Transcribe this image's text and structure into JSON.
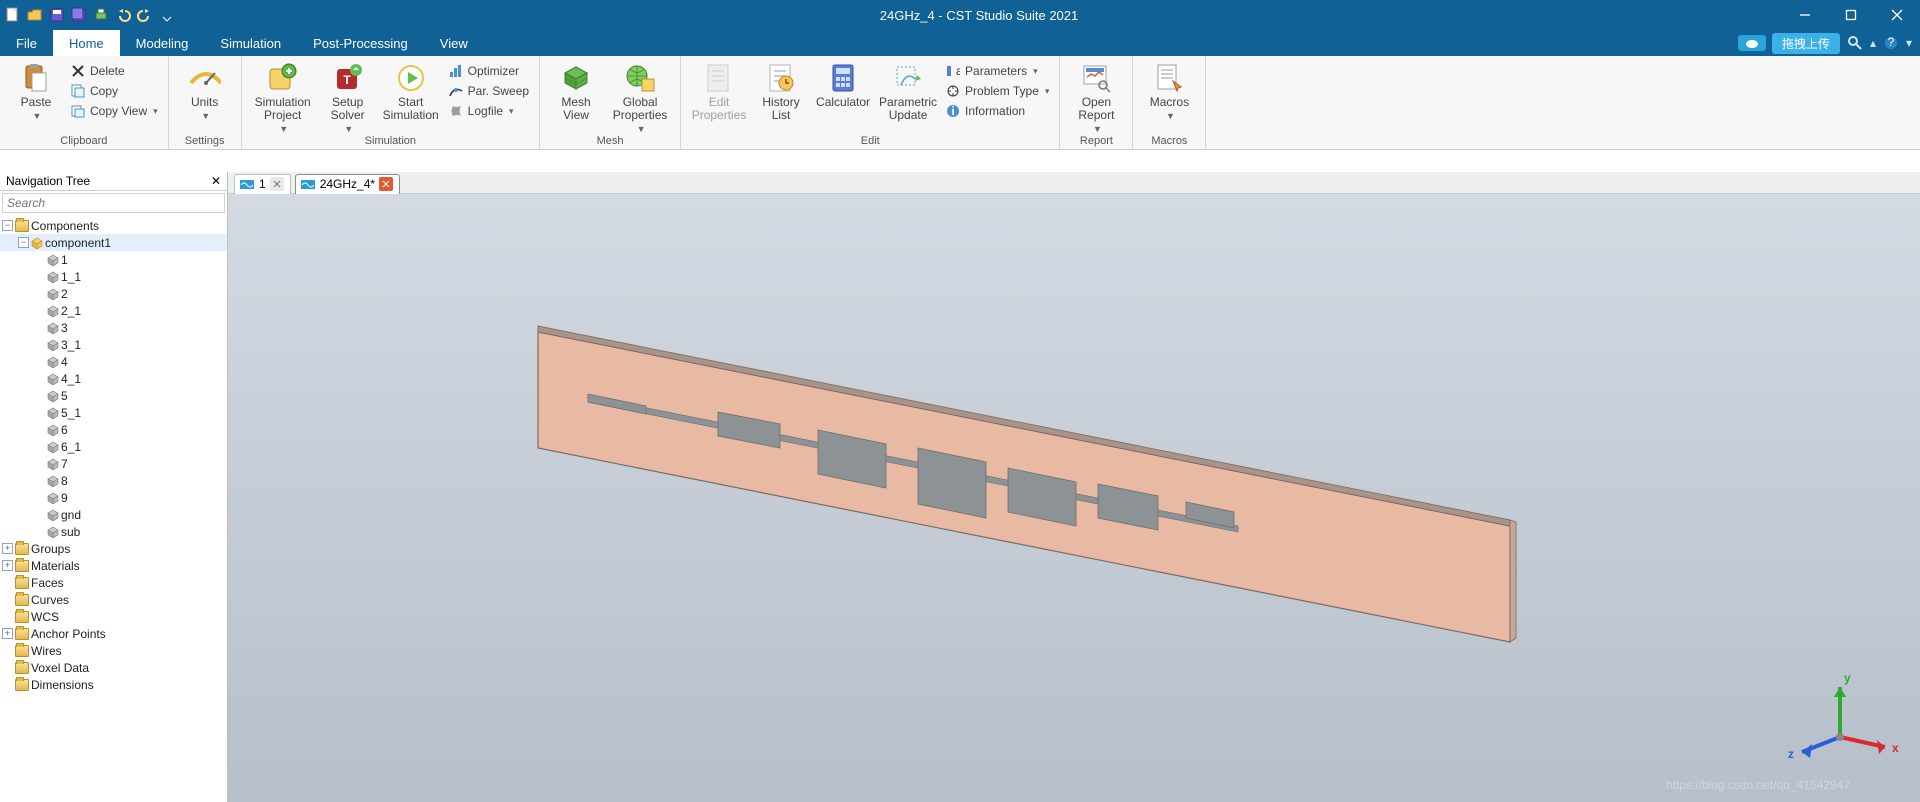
{
  "title": "24GHz_4 - CST Studio Suite 2021",
  "qat_items": [
    "new-icon",
    "open-icon",
    "save-icon",
    "saveall-icon",
    "print-icon",
    "undo-icon",
    "redo-icon"
  ],
  "menu_tabs": [
    "File",
    "Home",
    "Modeling",
    "Simulation",
    "Post-Processing",
    "View"
  ],
  "active_tab": "Home",
  "right_pill": "拖拽上传",
  "ribbon": {
    "clipboard": {
      "label": "Clipboard",
      "paste": "Paste",
      "delete": "Delete",
      "copy": "Copy",
      "copyview": "Copy View"
    },
    "settings": {
      "label": "Settings",
      "units": "Units"
    },
    "simulation": {
      "label": "Simulation",
      "simproj": "Simulation\nProject",
      "setup": "Setup\nSolver",
      "start": "Start\nSimulation",
      "optimizer": "Optimizer",
      "parsweep": "Par. Sweep",
      "logfile": "Logfile"
    },
    "mesh": {
      "label": "Mesh",
      "meshview": "Mesh\nView",
      "globalprops": "Global\nProperties"
    },
    "edit": {
      "label": "Edit",
      "editprops": "Edit\nProperties",
      "history": "History\nList",
      "calculator": "Calculator",
      "paramupdate": "Parametric\nUpdate",
      "parameters": "Parameters",
      "problemtype": "Problem Type",
      "information": "Information"
    },
    "report": {
      "label": "Report",
      "openreport": "Open\nReport"
    },
    "macros": {
      "label": "Macros",
      "macros": "Macros"
    }
  },
  "doc_tabs": [
    {
      "label": "1",
      "active": false
    },
    {
      "label": "24GHz_4*",
      "active": true
    }
  ],
  "nav": {
    "title": "Navigation Tree",
    "search_placeholder": "Search",
    "tree": {
      "components": "Components",
      "component1": "component1",
      "leaves": [
        "1",
        "1_1",
        "2",
        "2_1",
        "3",
        "3_1",
        "4",
        "4_1",
        "5",
        "5_1",
        "6",
        "6_1",
        "7",
        "8",
        "9",
        "gnd",
        "sub"
      ],
      "rest": [
        "Groups",
        "Materials",
        "Faces",
        "Curves",
        "WCS",
        "Anchor Points",
        "Wires",
        "Voxel Data",
        "Dimensions"
      ]
    }
  },
  "triad": {
    "x": "x",
    "y": "y",
    "z": "z"
  },
  "watermark": "https://blog.csdn.net/qq_41542947"
}
